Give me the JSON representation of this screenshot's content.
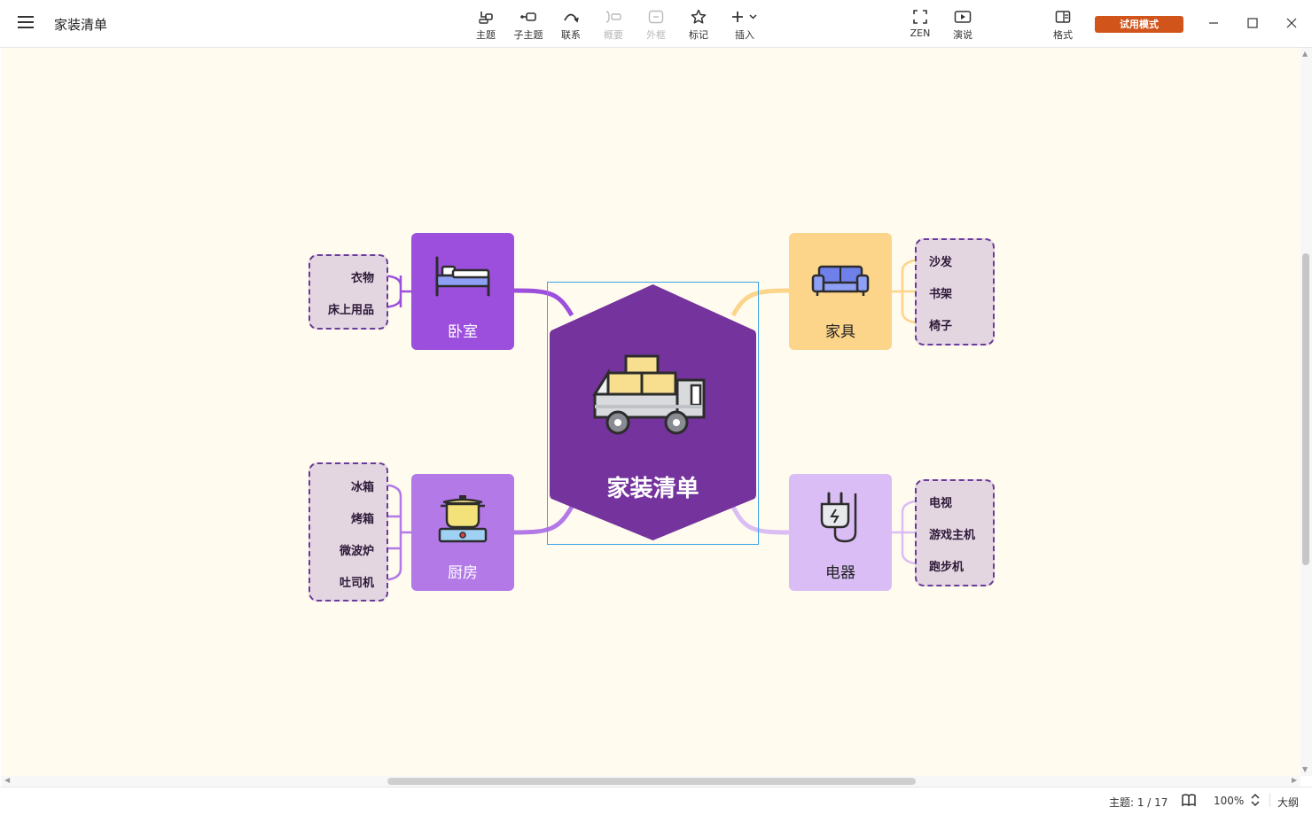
{
  "app": {
    "doc_title": "家装清单",
    "trial_label": "试用模式"
  },
  "toolbar": {
    "topic": "主题",
    "subtopic": "子主题",
    "relation": "联系",
    "summary": "概要",
    "boundary": "外框",
    "marker": "标记",
    "insert": "插入",
    "zen": "ZEN",
    "present": "演说",
    "format": "格式"
  },
  "mindmap": {
    "central": "家装清单",
    "branches": {
      "bedroom": {
        "label": "卧室",
        "items": [
          "衣物",
          "床上用品"
        ]
      },
      "kitchen": {
        "label": "厨房",
        "items": [
          "冰箱",
          "烤箱",
          "微波炉",
          "吐司机"
        ]
      },
      "furniture": {
        "label": "家具",
        "items": [
          "沙发",
          "书架",
          "椅子"
        ]
      },
      "appliances": {
        "label": "电器",
        "items": [
          "电视",
          "游戏主机",
          "跑步机"
        ]
      }
    }
  },
  "status": {
    "topic_count": "主题: 1 / 17",
    "zoom": "100%",
    "outline": "大纲"
  },
  "colors": {
    "canvas": "#fffbee",
    "central": "#74339d",
    "bedroom": "#9c4fdd",
    "kitchen": "#b279e7",
    "furniture": "#fcd48a",
    "appliances": "#dbbdf5",
    "trial": "#d1541a"
  }
}
